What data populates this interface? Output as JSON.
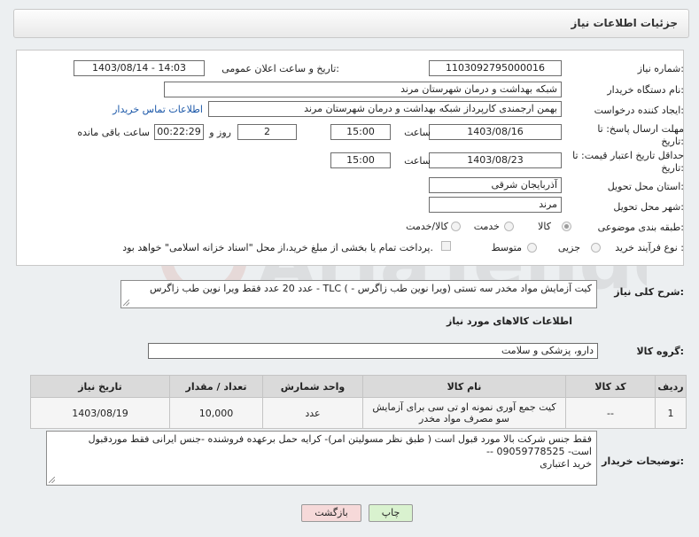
{
  "header": {
    "title": "جزئیات اطلاعات نیاز"
  },
  "form": {
    "need_number_label": "شماره نیاز:",
    "need_number": "1103092795000016",
    "announce_label": "تاریخ و ساعت اعلان عمومی:",
    "announce_value": "1403/08/14 - 14:03",
    "buyer_org_label": "نام دستگاه خریدار:",
    "buyer_org": "شبکه بهداشت و درمان شهرستان مرند",
    "requester_label": "ایجاد کننده درخواست:",
    "requester": "بهمن  ارجمندی کارپرداز شبکه بهداشت و درمان شهرستان مرند",
    "contact_link": "اطلاعات تماس خریدار",
    "deadline_label": "مهلت ارسال پاسخ: تا تاریخ:",
    "deadline_date": "1403/08/16",
    "time_label": "ساعت",
    "deadline_time": "15:00",
    "days_value": "2",
    "days_label": "روز و",
    "remaining_value": "00:22:29",
    "remaining_label": "ساعت باقی مانده",
    "validity_label": "حداقل تاریخ اعتبار قیمت: تا تاریخ:",
    "validity_date": "1403/08/23",
    "validity_time": "15:00",
    "province_label": "استان محل تحویل:",
    "province": "آذربایجان شرقی",
    "city_label": "شهر محل تحویل:",
    "city": "مرند",
    "category_label": "طبقه بندی موضوعی:",
    "category_options": [
      "کالا",
      "خدمت",
      "کالا/خدمت"
    ],
    "process_label": "نوع فرآیند خرید :",
    "process_options": [
      "جزیی",
      "متوسط"
    ],
    "payment_note": "پرداخت تمام یا بخشی از مبلغ خرید،از محل \"اسناد خزانه اسلامی\" خواهد بود."
  },
  "description": {
    "label": "شرح کلی نیاز:",
    "text": "کیت آزمایش مواد مخدر سه تستی (ویرا نوین طب زاگرس - )  TLC -  عدد 20 عدد فقط ویرا نوین طب زاگرس"
  },
  "goods": {
    "section_title": "اطلاعات کالاهای مورد نیاز",
    "group_label": "گروه کالا:",
    "group_value": "دارو، پزشکی و سلامت",
    "columns": [
      "ردیف",
      "کد کالا",
      "نام کالا",
      "واحد شمارش",
      "تعداد / مقدار",
      "تاریخ نیاز"
    ],
    "rows": [
      {
        "row": "1",
        "code": "--",
        "name": "کیت جمع آوری نمونه او تی سی برای آزمایش سو مصرف مواد مخدر",
        "unit": "عدد",
        "qty": "10,000",
        "date": "1403/08/19"
      }
    ]
  },
  "notes": {
    "label": "توضیحات خریدار:",
    "lines": [
      "فقط جنس  شرکت بالا مورد قبول است  ( طبق نظر مسولیتن امر)- کرایه حمل برعهده فروشنده -جنس ایرانی فقط موردقبول",
      "است- 09059778525  --",
      "خرید اعتباری"
    ]
  },
  "buttons": {
    "print": "چاپ",
    "back": "بازگشت"
  },
  "colors": {
    "print_bg": "#d9f2cf",
    "back_bg": "#f6d9d9",
    "link": "#1a57a8"
  }
}
